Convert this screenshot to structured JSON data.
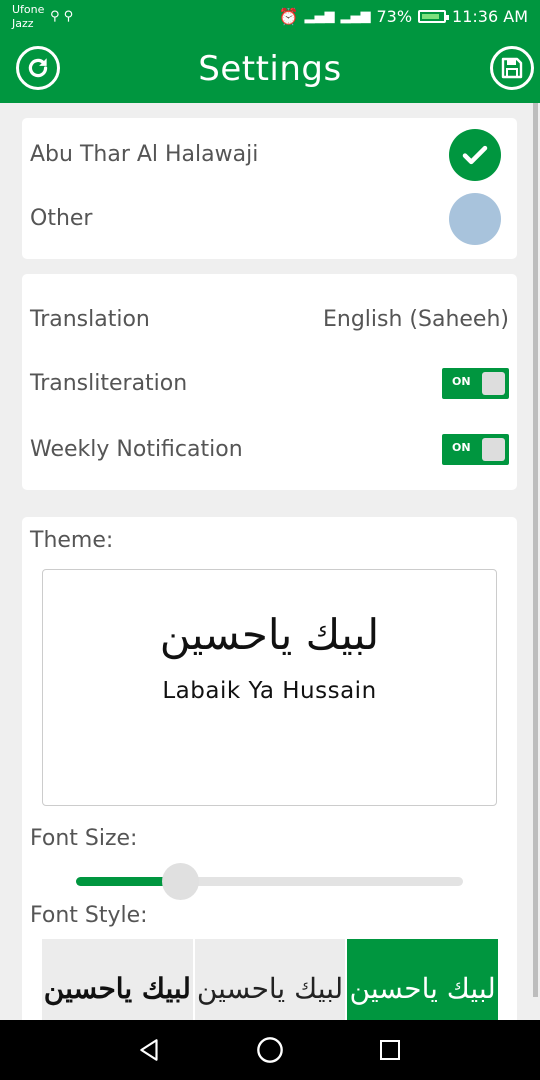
{
  "status_bar": {
    "carrier_line1": "Ufone",
    "carrier_line2": "Jazz",
    "battery": "73%",
    "time": "11:36 AM",
    "icons": [
      "usb-icon",
      "usb-icon",
      "alarm-icon",
      "signal-icon",
      "signal-icon",
      "battery-icon"
    ]
  },
  "app_bar": {
    "title": "Settings",
    "left_icon": "refresh-icon",
    "right_icon": "save-icon"
  },
  "reciter": {
    "options": [
      {
        "label": "Abu Thar Al Halawaji",
        "selected": true
      },
      {
        "label": "Other",
        "selected": false
      }
    ]
  },
  "preferences": {
    "translation_label": "Translation",
    "translation_value": "English (Saheeh)",
    "transliteration_label": "Transliteration",
    "transliteration_state": "ON",
    "notification_label": "Weekly Notification",
    "notification_state": "ON"
  },
  "theme": {
    "label": "Theme:",
    "preview_arabic": "لبيك ياحسين",
    "preview_latin": "Labaik Ya Hussain",
    "font_size_label": "Font Size:",
    "font_size_level": 0.27,
    "font_style_label": "Font Style:",
    "font_styles": [
      "لبيك ياحسين",
      "لبيك ياحسين",
      "لبيك ياحسين"
    ],
    "selected_font_style": 2
  },
  "colors": {
    "accent": "#00963f",
    "radio_unselected": "#a8c3dc"
  },
  "nav_bar": {
    "icons": [
      "back-icon",
      "home-icon",
      "recents-icon"
    ]
  }
}
